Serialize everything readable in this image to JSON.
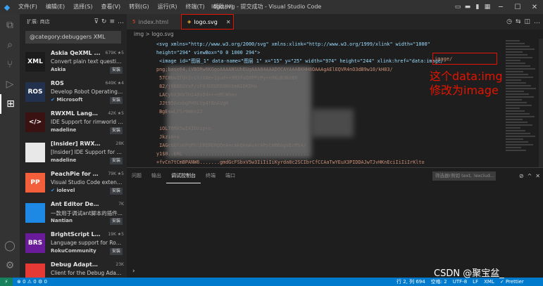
{
  "titlebar": {
    "menu": [
      "文件(F)",
      "编辑(E)",
      "选择(S)",
      "查看(V)",
      "转到(G)",
      "运行(R)",
      "终端(T)",
      "帮助(H)"
    ],
    "title": "logo.svg - 提交成功 - Visual Studio Code"
  },
  "sidebar": {
    "header": "扩展: 商店",
    "search_value": "@category:debuggers XML",
    "extensions": [
      {
        "name": "Askia QeXML ...",
        "stats": "679K ★5",
        "desc": "Convert plain text questionn...",
        "publisher": "Askia",
        "install": "安装",
        "icon_text": "XML",
        "icon_color": "#1b1b1b"
      },
      {
        "name": "ROS",
        "stats": "649K ★4",
        "desc": "Develop Robot Operating Sy...",
        "publisher": "Microsoft",
        "install": "安装",
        "icon_text": "ROS",
        "icon_color": "#22314e",
        "verified": true
      },
      {
        "name": "RWXML Langu...",
        "stats": "42K ★5",
        "desc": "IDE Support for rimworld m...",
        "publisher": "madeline",
        "install": "安装",
        "icon_text": "</>",
        "icon_color": "#3a1212"
      },
      {
        "name": "[Insider] RWXML L...",
        "stats": "28K",
        "desc": "[Insider] IDE Support for rim...",
        "publisher": "madeline",
        "install": "安装",
        "icon_text": "",
        "icon_color": "#e8e8e8"
      },
      {
        "name": "PeachPie for Vi...",
        "stats": "79K ★5",
        "desc": "Visual Studio Code extensio...",
        "publisher": "iolevel",
        "install": "安装",
        "icon_text": "PP",
        "icon_color": "#f25f3a",
        "verified": true
      },
      {
        "name": "Ant Editor Debug",
        "stats": "7K",
        "desc": "一款用于调试ant脚本的插件...",
        "publisher": "Nantian",
        "install": "安装",
        "icon_text": "",
        "icon_color": "#1e88e5"
      },
      {
        "name": "BrightScript La...",
        "stats": "19K ★5",
        "desc": "Language support for Roku'...",
        "publisher": "RokuCommunity",
        "install": "安装",
        "icon_text": "BRS",
        "icon_color": "#6a1b9a"
      },
      {
        "name": "Debug Adapter for...",
        "stats": "23K",
        "desc": "Client for the Debug Adapte...",
        "publisher": "",
        "install": "",
        "icon_text": "",
        "icon_color": "#e53935"
      }
    ]
  },
  "editor": {
    "tabs": [
      {
        "label": "index.html",
        "type": "html"
      },
      {
        "label": "logo.svg",
        "type": "svg",
        "active": true
      }
    ],
    "breadcrumb": "img > logo.svg",
    "lines": [
      {
        "num": "",
        "text": "<svg xmlns=\"http://www.w3.org/2000/svg\" xmlns:xlink=\"http://www.w3.org/1999/xlink\" width=\"1000\""
      },
      {
        "num": "",
        "text": "height=\"294\" viewBox=\"0 0 1000 294\">"
      },
      {
        "num": "",
        "text": "  <image id=\"图层_1\" data-name=\"图层 1\" x=\"15\" y=\"25\" width=\"974\" height=\"244\" xlink:href=\"data:image/"
      },
      {
        "num": "",
        "text": "png;base64,iVBORw0KGgoAAAANSUhEUgAAA84AAADOCAYAAABKHH8OAAAgAElEQVR4nO3dB9w10/kH83/"
      },
      {
        "num": "",
        "text": "                                                          57C0bvZfQ+2rLY/X8e+1yud++9M3fuOXPPzPy+n8KuB3KeB9"
      },
      {
        "num": "",
        "text": "                                                          82/j0BBEGYxF/zFUJERERERMXGmNIDKDHx"
      },
      {
        "num": "",
        "text": "                                                                    LACyhX3NV7H148sD4+++eMlWheo"
      },
      {
        "num": "",
        "text": "                                                                    JJt95AxxbgPH9LVp4fBnAVgH"
      },
      {
        "num": "",
        "text": "                                                                    BgEswLYSr9mKe2J"
      },
      {
        "num": "",
        "text": ""
      },
      {
        "num": "",
        "text": "                                                                    iOL70MA5wI4IUzip+s"
      },
      {
        "num": "",
        "text": "                                    Jkzim+o"
      },
      {
        "num": "",
        "text": "                                    IAGcGGYxKPqPhlERERERQQeA+cmkQkmAvArAPsCmM6bgVErMYA/"
      },
      {
        "num": "",
        "text": "y1$0..ERL                           ..........................................."
      },
      {
        "num": "",
        "text": "+fvCn7tCmBPANW6.......gmdGcFSbxV5w3IiIiIiKyrda8c2SCIbrCfCCAaTwYEuX3PIDDAJwTJvHKnEciIiIiIrKlto"
      }
    ],
    "highlight_text": "image/",
    "annotation": [
      "这个data:img",
      "修改为image"
    ]
  },
  "panel": {
    "tabs": [
      "问题",
      "输出",
      "调试控制台",
      "终端",
      "端口"
    ],
    "active_tab": "调试控制台",
    "filter_placeholder": "筛选器(例如 text, !exclud...",
    "prompt": "›"
  },
  "statusbar": {
    "remote": "⚡",
    "left": "⊗ 0 ⚠ 0   ⚙ 0",
    "right": [
      "行 2, 列 694",
      "空格: 2",
      "UTF-8",
      "LF",
      "XML",
      "✓ Prettier"
    ]
  },
  "watermark": "CSDN @聚宝盆_"
}
